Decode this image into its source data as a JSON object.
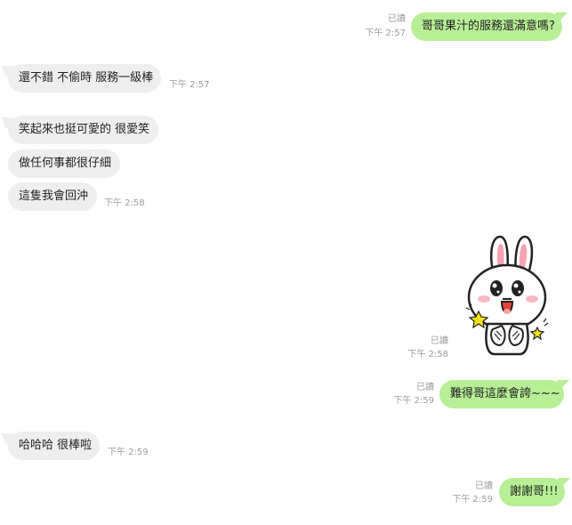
{
  "messages": [
    {
      "id": "m1",
      "side": "out",
      "text": "哥哥果汁的服務還滿意嗎?",
      "read": "已讀",
      "time": "下午 2:57"
    },
    {
      "id": "m2",
      "side": "in",
      "text": "還不錯 不偷時 服務一級棒",
      "time": "下午 2:57"
    },
    {
      "id": "m3",
      "side": "in",
      "text": "笑起來也挺可愛的 很愛笑"
    },
    {
      "id": "m4",
      "side": "in",
      "text": "做任何事都很仔細"
    },
    {
      "id": "m5",
      "side": "in",
      "text": "這隻我會回沖",
      "time": "下午 2:58"
    },
    {
      "id": "m6",
      "side": "out",
      "type": "sticker",
      "sticker": "rabbit-cony-clapping",
      "read": "已讀",
      "time": "下午 2:58"
    },
    {
      "id": "m7",
      "side": "out",
      "text": "難得哥這麼會誇~~~",
      "read": "已讀",
      "time": "下午 2:59"
    },
    {
      "id": "m8",
      "side": "in",
      "text": "哈哈哈 很棒啦",
      "time": "下午 2:59"
    },
    {
      "id": "m9",
      "side": "out",
      "text": "謝謝哥!!!",
      "read": "已讀",
      "time": "下午 2:59"
    }
  ],
  "colors": {
    "incoming_bubble": "#eeeeee",
    "outgoing_bubble": "#b8ee95",
    "meta_text": "#9b9b9b"
  }
}
